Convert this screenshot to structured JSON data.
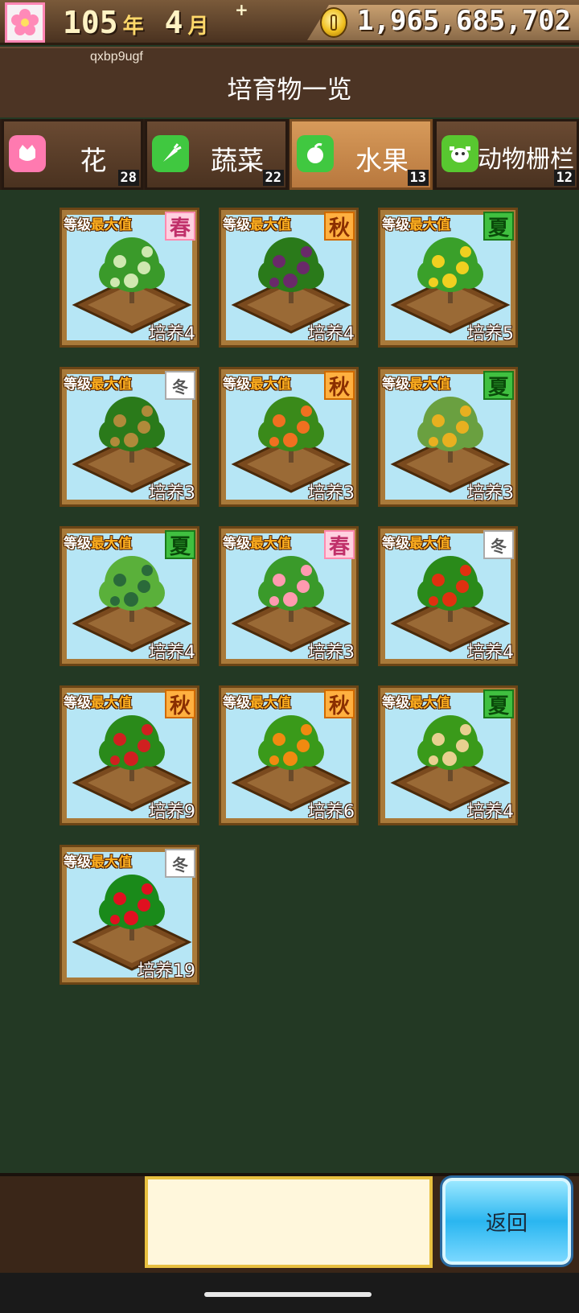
{
  "header": {
    "year": "105",
    "year_unit": "年",
    "month": "4",
    "month_unit": "月",
    "plus": "+",
    "money": "1,965,685,702",
    "username": "qxbp9ugf",
    "title": "培育物一览"
  },
  "tabs": [
    {
      "label": "花",
      "count": "28",
      "icon": "flower-icon",
      "color": "#ff7ab0"
    },
    {
      "label": "蔬菜",
      "count": "22",
      "icon": "carrot-icon",
      "color": "#40c840"
    },
    {
      "label": "水果",
      "count": "13",
      "icon": "apple-icon",
      "color": "#40c840",
      "active": true
    },
    {
      "label": "动物栅栏",
      "count": "12",
      "icon": "cow-icon",
      "color": "#58c830"
    }
  ],
  "level_label": "等级",
  "level_value": "最大值",
  "cards": [
    {
      "season": "春",
      "season_type": "spring",
      "culture": "培养4",
      "plant": "melon-plant-icon"
    },
    {
      "season": "秋",
      "season_type": "autumn",
      "culture": "培养4",
      "plant": "grape-plant-icon"
    },
    {
      "season": "夏",
      "season_type": "summer",
      "culture": "培养5",
      "plant": "banana-plant-icon"
    },
    {
      "season": "冬",
      "season_type": "winter",
      "culture": "培养3",
      "plant": "kiwi-plant-icon"
    },
    {
      "season": "秋",
      "season_type": "autumn",
      "culture": "培养3",
      "plant": "persimmon-plant-icon"
    },
    {
      "season": "夏",
      "season_type": "summer",
      "culture": "培养3",
      "plant": "pineapple-plant-icon"
    },
    {
      "season": "夏",
      "season_type": "summer",
      "culture": "培养4",
      "plant": "watermelon-plant-icon"
    },
    {
      "season": "春",
      "season_type": "spring",
      "culture": "培养3",
      "plant": "peach-plant-icon"
    },
    {
      "season": "冬",
      "season_type": "winter",
      "culture": "培养4",
      "plant": "tomato-plant-icon"
    },
    {
      "season": "秋",
      "season_type": "autumn",
      "culture": "培养9",
      "plant": "apple-plant-icon"
    },
    {
      "season": "秋",
      "season_type": "autumn",
      "culture": "培养6",
      "plant": "orange-plant-icon"
    },
    {
      "season": "夏",
      "season_type": "summer",
      "culture": "培养4",
      "plant": "pear-plant-icon"
    },
    {
      "season": "冬",
      "season_type": "winter",
      "culture": "培养19",
      "plant": "strawberry-plant-icon"
    }
  ],
  "footer": {
    "back_label": "返回"
  }
}
